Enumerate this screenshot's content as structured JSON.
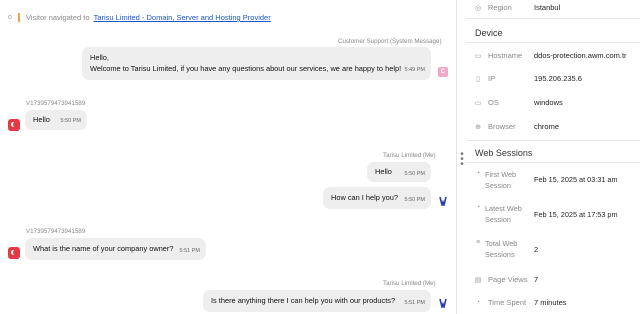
{
  "nav": {
    "prefix": "Visitor navigated to",
    "link": "Tarisu Limited - Domain, Server and Hosting Provider"
  },
  "messages": [
    {
      "sender": "Customer Support (System Message)",
      "line1": "Hello,",
      "line2": "Welcome to Tarisu Limited, if you have any questions about our services, we are happy to help!",
      "time": "5:49 PM",
      "avatar": "C"
    },
    {
      "sender": "V1739579473941589",
      "text": "Hello",
      "time": "5:50 PM"
    },
    {
      "sender": "Tarisu Limited (Me)",
      "text": "Hello",
      "time": "5:50 PM"
    },
    {
      "text": "How can I help you?",
      "time": "5:50 PM"
    },
    {
      "sender": "V1739579473941589",
      "text": "What is the name of your company owner?",
      "time": "5:51 PM"
    },
    {
      "sender": "Tarisu Limited (Me)",
      "text": "Is there anything there I can help you with our products?",
      "time": "5:51 PM"
    }
  ],
  "panel": {
    "region": {
      "label": "Region",
      "value": "Istanbul",
      "icon": "location-icon"
    },
    "device_title": "Device",
    "device": [
      {
        "label": "Hostname",
        "value": "ddos-protection.awm.com.tr",
        "icon": "hostname-icon"
      },
      {
        "label": "IP",
        "value": "195.206.235.6",
        "icon": "ip-icon"
      },
      {
        "label": "OS",
        "value": "windows",
        "icon": "monitor-icon"
      },
      {
        "label": "Browser",
        "value": "chrome",
        "icon": "globe-icon"
      }
    ],
    "sessions_title": "Web Sessions",
    "sessions": [
      {
        "label": "First Web Session",
        "value": "Feb 15, 2025 at 03:31 am",
        "icon": "clock-icon"
      },
      {
        "label": "Latest Web Session",
        "value": "Feb 15, 2025 at 17:53 pm",
        "icon": "clock-icon"
      },
      {
        "label": "Total Web Sessions",
        "value": "2",
        "icon": "stack-icon"
      },
      {
        "label": "Page Views",
        "value": "7",
        "icon": "document-icon"
      },
      {
        "label": "Time Spent",
        "value": "7 minutes",
        "icon": "clock-icon"
      }
    ]
  },
  "colors": {
    "link": "#1a56c8",
    "bubble": "#eeeeee",
    "visitor_avatar": "#e63946",
    "support_avatar": "#f3a6c6",
    "nav_marker": "#f0a24a"
  }
}
